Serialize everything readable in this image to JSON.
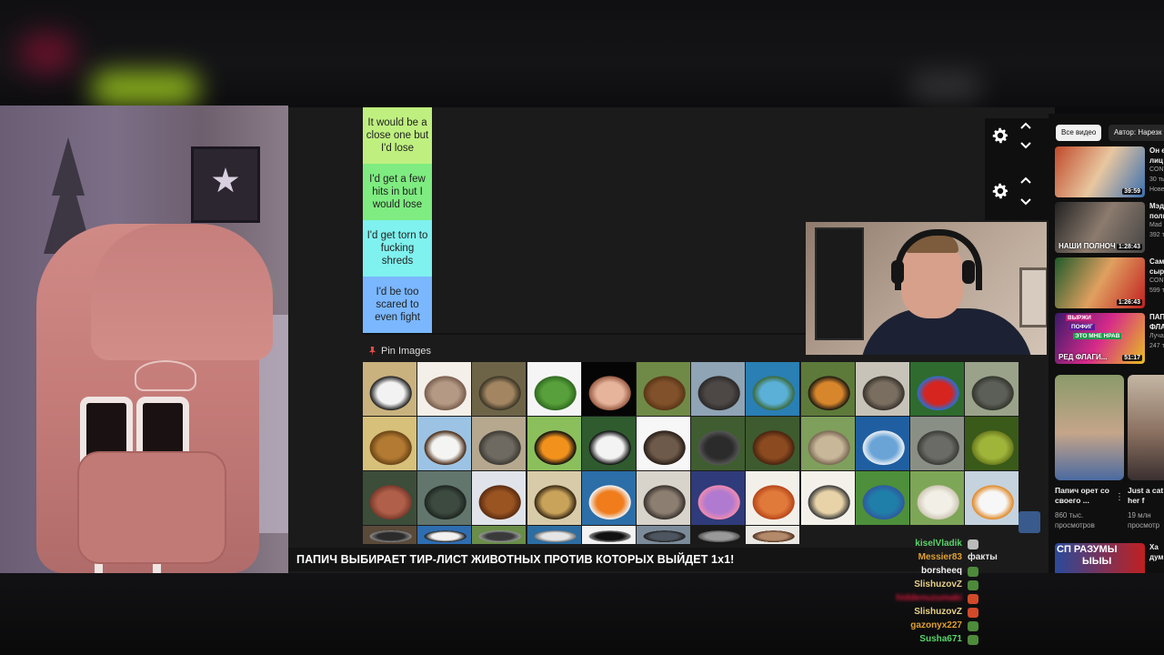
{
  "tiers": [
    {
      "label": "It would be a close one but I'd lose",
      "color": "#bff07f"
    },
    {
      "label": "I'd get a few hits in but I would lose",
      "color": "#7eec80"
    },
    {
      "label": "I'd get torn to fucking shreds",
      "color": "#7ff1ee"
    },
    {
      "label": "I'd be too scared to even fight",
      "color": "#7ab7ff"
    }
  ],
  "pin_images_label": "Pin Images",
  "banner": "ПАПИЧ ВЫБИРАЕТ ТИР-ЛИСТ ЖИВОТНЫХ ПРОТИВ КОТОРЫХ ВЫЙДЕТ 1х1!",
  "animals": [
    {
      "name": "zebra",
      "colors": [
        "#c9b27e",
        "#f2f2f2",
        "#222"
      ]
    },
    {
      "name": "mouse",
      "colors": [
        "#f4efe8",
        "#b49a85",
        "#7a5e4e"
      ]
    },
    {
      "name": "deer",
      "colors": [
        "#6d6448",
        "#a38661",
        "#3b3526"
      ]
    },
    {
      "name": "lizard",
      "colors": [
        "#f5f5f5",
        "#58a03b",
        "#2f6b1f"
      ]
    },
    {
      "name": "squid",
      "colors": [
        "#050505",
        "#e6b39b",
        "#9b5e46"
      ]
    },
    {
      "name": "brown-bear",
      "colors": [
        "#6f8a46",
        "#80512a",
        "#5a3617"
      ]
    },
    {
      "name": "hippo",
      "colors": [
        "#8fa4b5",
        "#4d4846",
        "#2c2a29"
      ]
    },
    {
      "name": "turtle",
      "colors": [
        "#2a7fb4",
        "#5bb0d8",
        "#3d6b3b"
      ]
    },
    {
      "name": "tiger",
      "colors": [
        "#5d7a3a",
        "#d8862b",
        "#1f1a12"
      ]
    },
    {
      "name": "wolf",
      "colors": [
        "#c7c3b9",
        "#7a6e60",
        "#3a342d"
      ]
    },
    {
      "name": "parrot",
      "colors": [
        "#2f6b2e",
        "#d6241f",
        "#2a6fd0"
      ]
    },
    {
      "name": "rhino-gray",
      "colors": [
        "#9aa38a",
        "#5c5f57",
        "#35372f"
      ]
    },
    {
      "name": "lion",
      "colors": [
        "#d6c07a",
        "#b27a32",
        "#6b4517"
      ]
    },
    {
      "name": "eagle",
      "colors": [
        "#9cc3e3",
        "#f4f4f2",
        "#4a2c17"
      ]
    },
    {
      "name": "rhino",
      "colors": [
        "#b5a88f",
        "#6e6a61",
        "#3e3b35"
      ]
    },
    {
      "name": "oriole",
      "colors": [
        "#8bbf5c",
        "#f2921c",
        "#111"
      ]
    },
    {
      "name": "panda",
      "colors": [
        "#2f5b2f",
        "#f3f3f3",
        "#111"
      ]
    },
    {
      "name": "ferret",
      "colors": [
        "#f7f7f7",
        "#6e5a4a",
        "#2b2019"
      ]
    },
    {
      "name": "gorilla",
      "colors": [
        "#3f5d30",
        "#2b2b2b",
        "#555"
      ]
    },
    {
      "name": "orangutan",
      "colors": [
        "#3e5a2f",
        "#8b4a1f",
        "#4a2410"
      ]
    },
    {
      "name": "llama",
      "colors": [
        "#7f9f5c",
        "#c9b79a",
        "#7b6a55"
      ]
    },
    {
      "name": "shark",
      "colors": [
        "#1f5fa1",
        "#6aa4d6",
        "#e8eef4"
      ]
    },
    {
      "name": "elephant",
      "colors": [
        "#8a8f86",
        "#6a6b66",
        "#3b3c38"
      ]
    },
    {
      "name": "snake",
      "colors": [
        "#3a5a1a",
        "#9fb53a",
        "#6d7d1f"
      ]
    },
    {
      "name": "starfish",
      "colors": [
        "#3c4d3a",
        "#b0604a",
        "#7c3a2c"
      ]
    },
    {
      "name": "crocodile",
      "colors": [
        "#62766e",
        "#3c4a40",
        "#1e2620"
      ]
    },
    {
      "name": "horse",
      "colors": [
        "#e0e4ea",
        "#9a5422",
        "#5b2c10"
      ]
    },
    {
      "name": "cheetah",
      "colors": [
        "#d8cba9",
        "#c9a35a",
        "#3a2a15"
      ]
    },
    {
      "name": "clownfish",
      "colors": [
        "#2b6ea8",
        "#f07c1c",
        "#f2f2f2"
      ]
    },
    {
      "name": "cat",
      "colors": [
        "#d9d4cb",
        "#8c7e70",
        "#3a3430"
      ]
    },
    {
      "name": "octopus",
      "colors": [
        "#2f3b7a",
        "#b07ad0",
        "#f08ab0"
      ]
    },
    {
      "name": "crab",
      "colors": [
        "#f3f0ea",
        "#e07a3a",
        "#b8461a"
      ]
    },
    {
      "name": "dog",
      "colors": [
        "#f4f1ea",
        "#e8d3a8",
        "#3b3b3b"
      ]
    },
    {
      "name": "peacock",
      "colors": [
        "#4d8f3a",
        "#1f7fa8",
        "#2e5aa0"
      ]
    },
    {
      "name": "sheep",
      "colors": [
        "#7ea657",
        "#f1efe6",
        "#cfc8b6"
      ]
    },
    {
      "name": "swan",
      "colors": [
        "#c5d3df",
        "#f7f7f7",
        "#e08a2a"
      ]
    },
    {
      "name": "row4-a",
      "colors": [
        "#5a4a3a",
        "#2b2b2b",
        "#888"
      ]
    },
    {
      "name": "row4-b",
      "colors": [
        "#2e6db0",
        "#f1f1f1",
        "#1a1a1a"
      ]
    },
    {
      "name": "row4-c",
      "colors": [
        "#6a8d4a",
        "#3a3a3a",
        "#999"
      ]
    },
    {
      "name": "row4-d",
      "colors": [
        "#2d6ea2",
        "#e5e5e5",
        "#777"
      ]
    },
    {
      "name": "cow",
      "colors": [
        "#f3f3f3",
        "#111",
        "#888"
      ]
    },
    {
      "name": "row4-f",
      "colors": [
        "#7c8b9a",
        "#4c5560",
        "#222"
      ]
    },
    {
      "name": "row4-g",
      "colors": [
        "#1a1a1a",
        "#999",
        "#555"
      ]
    },
    {
      "name": "row4-h",
      "colors": [
        "#eae8e3",
        "#b38a6a",
        "#553322"
      ]
    }
  ],
  "chat": [
    {
      "user": "kiselVladik",
      "color": "#59d46a",
      "emote": "#bbbbbb",
      "msg": ""
    },
    {
      "user": "Messier83",
      "color": "#e0a030",
      "emote": "",
      "msg": "факты"
    },
    {
      "user": "borsheeq",
      "color": "#f0f0f0",
      "emote": "#4d8a3a",
      "msg": ""
    },
    {
      "user": "SlishuzovZ",
      "color": "#e7d088",
      "emote": "#4d8a3a",
      "msg": ""
    },
    {
      "user": "hiddenuzumaki",
      "color": "#d0163a",
      "emote": "#d14a2a",
      "msg": ""
    },
    {
      "user": "SlishuzovZ",
      "color": "#e7d088",
      "emote": "#d14a2a",
      "msg": ""
    },
    {
      "user": "gazonyx227",
      "color": "#e0a030",
      "emote": "#4d8a3a",
      "msg": ""
    },
    {
      "user": "Susha671",
      "color": "#59d46a",
      "emote": "#4d8a3a",
      "msg": ""
    }
  ],
  "sidebar": {
    "chip_active": "Все видео",
    "chip_other": "Автор: Нарезк",
    "videos": [
      {
        "title": "Он е",
        "meta1": "лиц",
        "meta2": "CONT",
        "meta3": "30 ть",
        "meta4": "Нове",
        "duration": "39:59",
        "colors": [
          "#c04a2a",
          "#e8c7a0",
          "#3a6fb0"
        ]
      },
      {
        "title": "Мэд",
        "meta1": "поли",
        "meta2": "Mad",
        "meta3": "392 т",
        "meta4": "",
        "duration": "1:28:43",
        "overlay": "НАШИ ПОЛНОЧ",
        "colors": [
          "#222",
          "#8c7b6e",
          "#444"
        ]
      },
      {
        "title": "Сам",
        "meta1": "сыр",
        "meta2": "CONT",
        "meta3": "599 т",
        "meta4": "",
        "duration": "1:26:43",
        "colors": [
          "#1f5a2a",
          "#e0a060",
          "#c02020"
        ]
      },
      {
        "title": "ПАП",
        "meta1": "ФЛА",
        "meta2": "Луча",
        "meta3": "247 т",
        "meta4": "",
        "duration": "51:17",
        "overlay": "РЕД ФЛАГИ...",
        "tag1": "ВЫРЖИ",
        "tag2": "ПОФИГ",
        "tag3": "ЭТО МНЕ НРАВ",
        "colors": [
          "#3a1a6a",
          "#d62a8a",
          "#e8c020"
        ]
      }
    ],
    "shorts": [
      {
        "title": "Папич орет со своего ...",
        "views1": "860 тыс.",
        "views2": "просмотров"
      },
      {
        "title": "Just a cat and her f",
        "views1": "19 млн",
        "views2": "просмотр"
      }
    ],
    "bottom": {
      "title1": "Ха",
      "title2": "дум",
      "thumb_text1": "СП РАЗУМЫ",
      "thumb_text2": "ЫЫЫ"
    }
  }
}
